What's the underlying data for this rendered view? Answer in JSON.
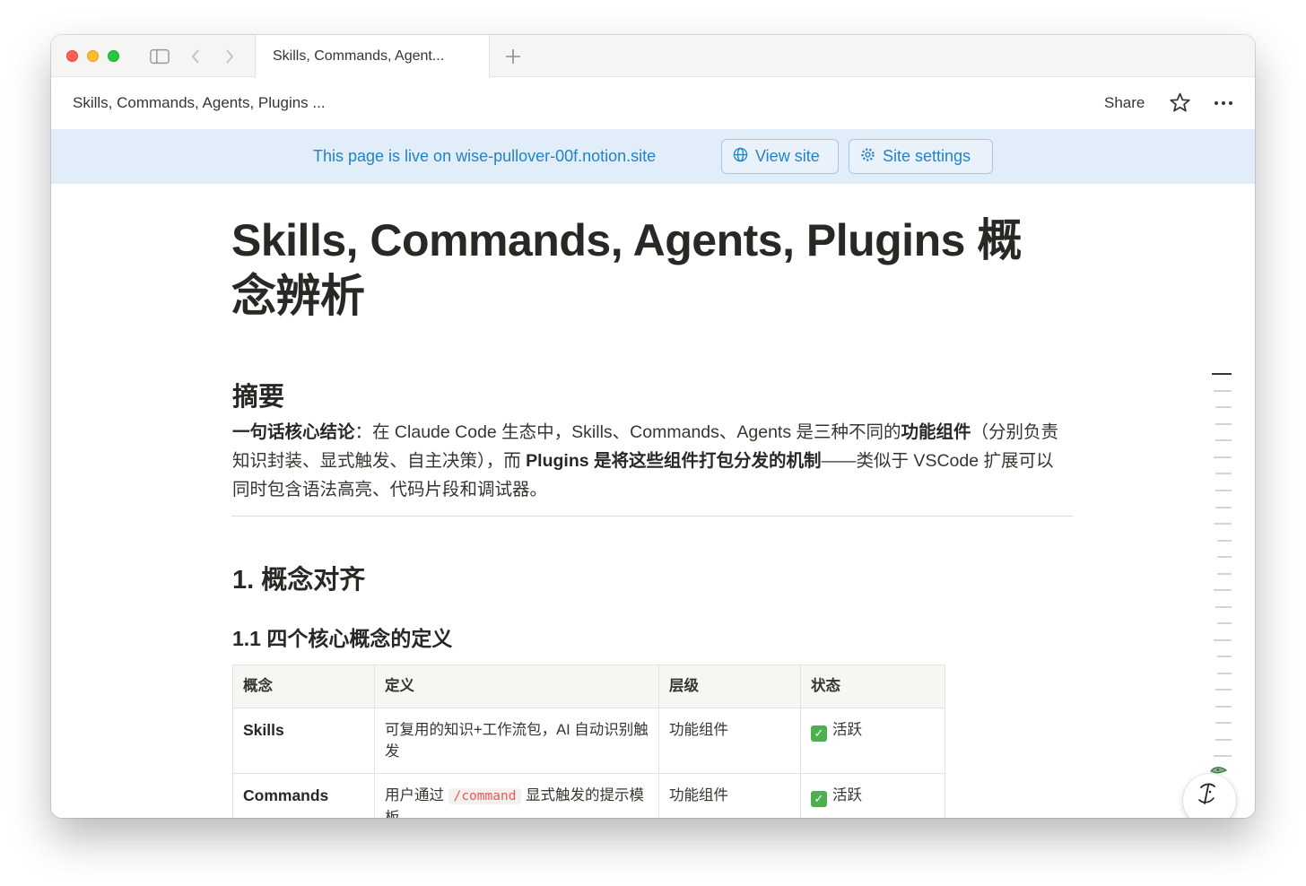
{
  "browser": {
    "tab_title": "Skills, Commands, Agent...",
    "new_tab_icon": "plus-icon"
  },
  "topbar": {
    "breadcrumb": "Skills, Commands, Agents, Plugins ...",
    "share_label": "Share"
  },
  "banner": {
    "text": "This page is live on wise-pullover-00f.notion.site",
    "view_site_label": "View site",
    "site_settings_label": "Site settings"
  },
  "page": {
    "title": "Skills, Commands, Agents, Plugins 概念辨析",
    "summary_heading": "摘要",
    "summary": {
      "lead": "一句话核心结论",
      "part1": "：在 Claude Code 生态中，Skills、Commands、Agents 是三种不同的",
      "bold1": "功能组件",
      "part2": "（分别负责知识封装、显式触发、自主决策），而 ",
      "bold2": "Plugins 是将这些组件打包分发的机制",
      "part3": "——类似于 VSCode 扩展可以同时包含语法高亮、代码片段和调试器。"
    },
    "section1_heading": "1. 概念对齐",
    "section1_1_heading": "1.1 四个核心概念的定义"
  },
  "table": {
    "headers": [
      "概念",
      "定义",
      "层级",
      "状态"
    ],
    "rows": [
      {
        "concept": "Skills",
        "def_before": "可复用的知识+工作流包，AI 自动识别触发",
        "def_code": "",
        "def_after": "",
        "level": "功能组件",
        "status": "活跃"
      },
      {
        "concept": "Commands",
        "def_before": "用户通过 ",
        "def_code": "/command",
        "def_after": " 显式触发的提示模板",
        "level": "功能组件",
        "status": "活跃"
      }
    ]
  },
  "colors": {
    "banner_bg": "#e1edf8",
    "banner_text": "#2383c4",
    "inline_code": "#eb5757",
    "status_check": "#4caf50"
  },
  "icons": {
    "sidebar": "sidebar-toggle-icon",
    "back": "chevron-left-icon",
    "forward": "chevron-right-icon",
    "favorite": "star-icon",
    "more": "ellipsis-icon",
    "view_site": "globe-icon",
    "site_settings": "gear-icon",
    "help": "notion-help-icon"
  }
}
